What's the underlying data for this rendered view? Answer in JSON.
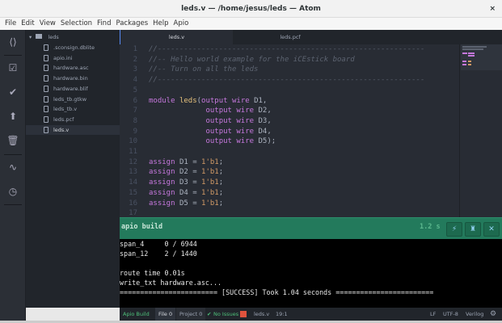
{
  "window": {
    "title": "leds.v — /home/jesus/leds — Atom",
    "close": "×"
  },
  "menu": [
    "File",
    "Edit",
    "View",
    "Selection",
    "Find",
    "Packages",
    "Help",
    "Apio"
  ],
  "tree": {
    "root": "leds",
    "files": [
      ".sconsign.dblite",
      "apio.ini",
      "hardware.asc",
      "hardware.bin",
      "hardware.blif",
      "leds_tb.gtkw",
      "leds_tb.v",
      "leds.pcf",
      "leds.v"
    ],
    "selected": "leds.v"
  },
  "tabs": [
    {
      "label": "leds.v",
      "active": true
    },
    {
      "label": "leds.pcf",
      "active": false
    }
  ],
  "editor": {
    "lines": [
      [
        [
          "c",
          "//-------------------------------------------------------------"
        ]
      ],
      [
        [
          "c",
          "//-- Hello world example for the iCEstick board"
        ]
      ],
      [
        [
          "c",
          "//-- Turn on all the leds"
        ]
      ],
      [
        [
          "c",
          "//-------------------------------------------------------------"
        ]
      ],
      [],
      [
        [
          "k",
          "module "
        ],
        [
          "f",
          "leds"
        ],
        [
          "",
          "("
        ],
        [
          "k",
          "output wire "
        ],
        [
          "",
          "D1,"
        ]
      ],
      [
        [
          "",
          "             "
        ],
        [
          "k",
          "output wire "
        ],
        [
          "",
          "D2,"
        ]
      ],
      [
        [
          "",
          "             "
        ],
        [
          "k",
          "output wire "
        ],
        [
          "",
          "D3,"
        ]
      ],
      [
        [
          "",
          "             "
        ],
        [
          "k",
          "output wire "
        ],
        [
          "",
          "D4,"
        ]
      ],
      [
        [
          "",
          "             "
        ],
        [
          "k",
          "output wire "
        ],
        [
          "",
          "D5);"
        ]
      ],
      [],
      [
        [
          "k",
          "assign "
        ],
        [
          "",
          "D1 = "
        ],
        [
          "n",
          "1'b1"
        ],
        [
          "",
          ";"
        ]
      ],
      [
        [
          "k",
          "assign "
        ],
        [
          "",
          "D2 = "
        ],
        [
          "n",
          "1'b1"
        ],
        [
          "",
          ";"
        ]
      ],
      [
        [
          "k",
          "assign "
        ],
        [
          "",
          "D3 = "
        ],
        [
          "n",
          "1'b1"
        ],
        [
          "",
          ";"
        ]
      ],
      [
        [
          "k",
          "assign "
        ],
        [
          "",
          "D4 = "
        ],
        [
          "n",
          "1'b1"
        ],
        [
          "",
          ";"
        ]
      ],
      [
        [
          "k",
          "assign "
        ],
        [
          "",
          "D5 = "
        ],
        [
          "n",
          "1'b1"
        ],
        [
          "",
          ";"
        ]
      ],
      []
    ]
  },
  "panel": {
    "title": "apio build",
    "time": "1.2 s",
    "buttons": [
      "⚡",
      "♜",
      "✕"
    ]
  },
  "terminal": [
    "span_4     0 / 6944",
    "span_12    2 / 1440",
    "",
    "route time 0.01s",
    "write_txt hardware.asc...",
    "======================== [SUCCESS] Took 1.04 seconds ========================"
  ],
  "status": {
    "apio": "Apio Build",
    "file": "File 0",
    "project": "Project 0",
    "issues": "No Issues",
    "filename": "leds.v",
    "cursor": "19:1",
    "eol": "LF",
    "encoding": "UTF-8",
    "grammar": "Verilog"
  },
  "colors": {
    "accent": "#237a5c",
    "bg": "#282c34"
  }
}
